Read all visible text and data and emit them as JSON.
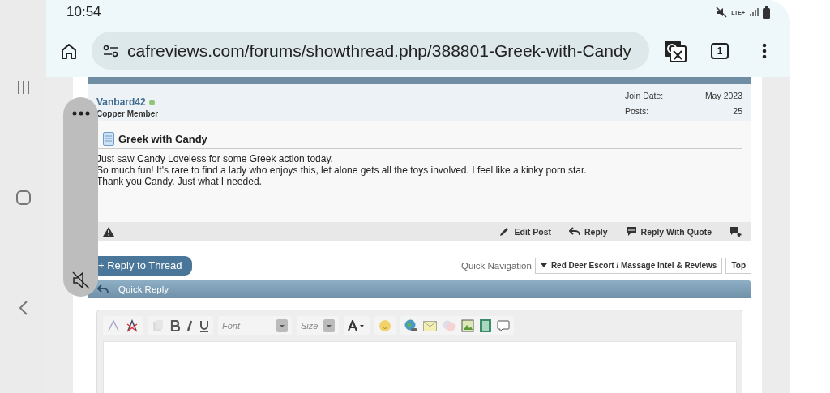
{
  "status_bar": {
    "time": "10:54",
    "network": "LTE+"
  },
  "browser": {
    "url": "cafreviews.com/forums/showthread.php/388801-Greek-with-Candy",
    "tab_count": "1"
  },
  "post": {
    "username": "Vanbard42",
    "online": true,
    "rank": "Copper Member",
    "stats": [
      {
        "label": "Join Date:",
        "value": "May 2023"
      },
      {
        "label": "Posts:",
        "value": "25"
      }
    ],
    "title": "Greek with Candy",
    "body": [
      "Just saw Candy Loveless for some Greek action today.",
      "So much fun! It's rare to find a lady who enjoys this, let alone gets all the toys involved. I feel like a kinky porn star.",
      "Thank you Candy. Just what I needed."
    ],
    "actions": [
      {
        "kind": "edit",
        "label": "Edit Post"
      },
      {
        "kind": "reply",
        "label": "Reply"
      },
      {
        "kind": "quote",
        "label": "Reply With Quote"
      },
      {
        "kind": "multiquote"
      }
    ]
  },
  "reply_to_thread": "+ Reply to Thread",
  "quick_navigation": {
    "label": "Quick Navigation",
    "forum": "Red Deer Escort / Massage Intel & Reviews",
    "top": "Top"
  },
  "quick_reply": {
    "title": "Quick Reply"
  },
  "editor": {
    "font": "Font",
    "size": "Size"
  }
}
